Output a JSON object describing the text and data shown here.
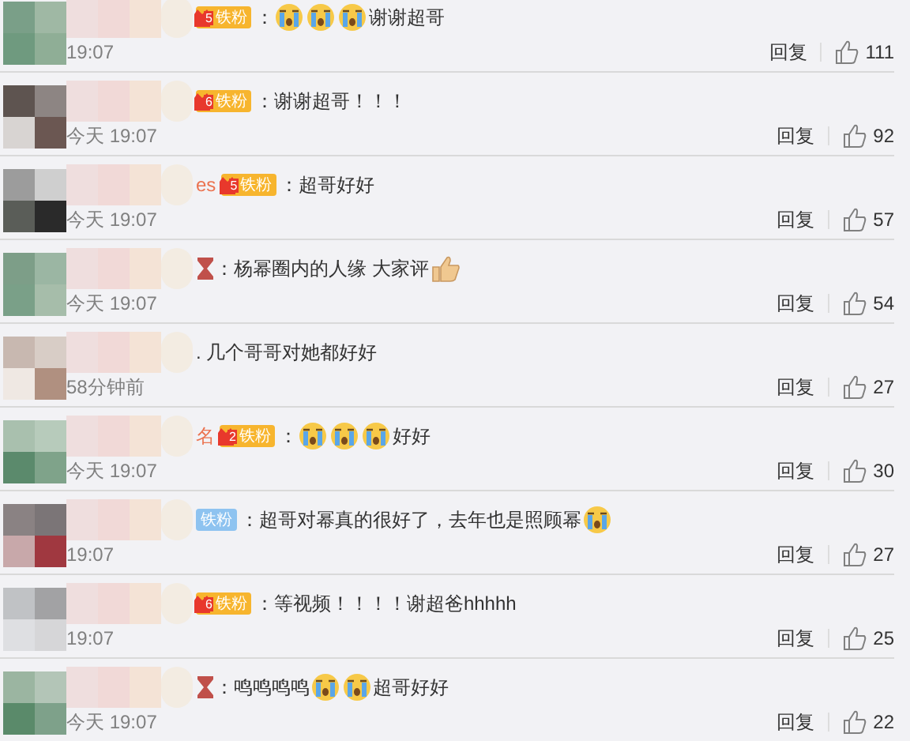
{
  "comments": [
    {
      "badge": {
        "level": "5",
        "kind": "gold",
        "label": "铁粉"
      },
      "content": [
        {
          "kind": "text",
          "text": "："
        },
        {
          "kind": "cry"
        },
        {
          "kind": "cry"
        },
        {
          "kind": "cry"
        },
        {
          "kind": "text",
          "text": "谢谢超哥"
        }
      ],
      "time": "19:07",
      "reply": "回复",
      "likes": "111"
    },
    {
      "badge": {
        "level": "6",
        "kind": "gold",
        "label": "铁粉"
      },
      "content": [
        {
          "kind": "text",
          "text": "：谢谢超哥！！！"
        }
      ],
      "time": "今天 19:07",
      "reply": "回复",
      "likes": "92"
    },
    {
      "name": "es",
      "badge": {
        "level": "5",
        "kind": "gold",
        "label": "铁粉"
      },
      "content": [
        {
          "kind": "text",
          "text": "：超哥好好"
        }
      ],
      "time": "今天 19:07",
      "reply": "回复",
      "likes": "57"
    },
    {
      "content": [
        {
          "kind": "hourglass"
        },
        {
          "kind": "text",
          "text": "：杨幂圈内的人缘 大家评"
        },
        {
          "kind": "thumb"
        }
      ],
      "time": "今天 19:07",
      "reply": "回复",
      "likes": "54"
    },
    {
      "content": [
        {
          "kind": "text",
          "text": ". 几个哥哥对她都好好"
        }
      ],
      "time": "58分钟前",
      "reply": "回复",
      "likes": "27"
    },
    {
      "name": "名",
      "badge": {
        "level": "2",
        "kind": "gold",
        "label": "铁粉"
      },
      "content": [
        {
          "kind": "text",
          "text": "："
        },
        {
          "kind": "cry"
        },
        {
          "kind": "cry"
        },
        {
          "kind": "cry"
        },
        {
          "kind": "text",
          "text": "好好"
        }
      ],
      "time": "今天 19:07",
      "reply": "回复",
      "likes": "30"
    },
    {
      "badge": {
        "kind": "blue",
        "label": "铁粉"
      },
      "content": [
        {
          "kind": "text",
          "text": "：超哥对幂真的很好了，去年也是照顾幂"
        },
        {
          "kind": "cry"
        }
      ],
      "time": "19:07",
      "reply": "回复",
      "likes": "27"
    },
    {
      "badge": {
        "level": "6",
        "kind": "gold",
        "label": "铁粉"
      },
      "content": [
        {
          "kind": "text",
          "text": "：等视频！！！！谢超爸hhhhh"
        }
      ],
      "time": "19:07",
      "reply": "回复",
      "likes": "25"
    },
    {
      "content": [
        {
          "kind": "hourglass"
        },
        {
          "kind": "text",
          "text": "：鸣鸣鸣鸣"
        },
        {
          "kind": "cry"
        },
        {
          "kind": "cry"
        },
        {
          "kind": "text",
          "text": "超哥好好"
        }
      ],
      "time": "今天 19:07",
      "reply": "回复",
      "likes": "22"
    }
  ]
}
